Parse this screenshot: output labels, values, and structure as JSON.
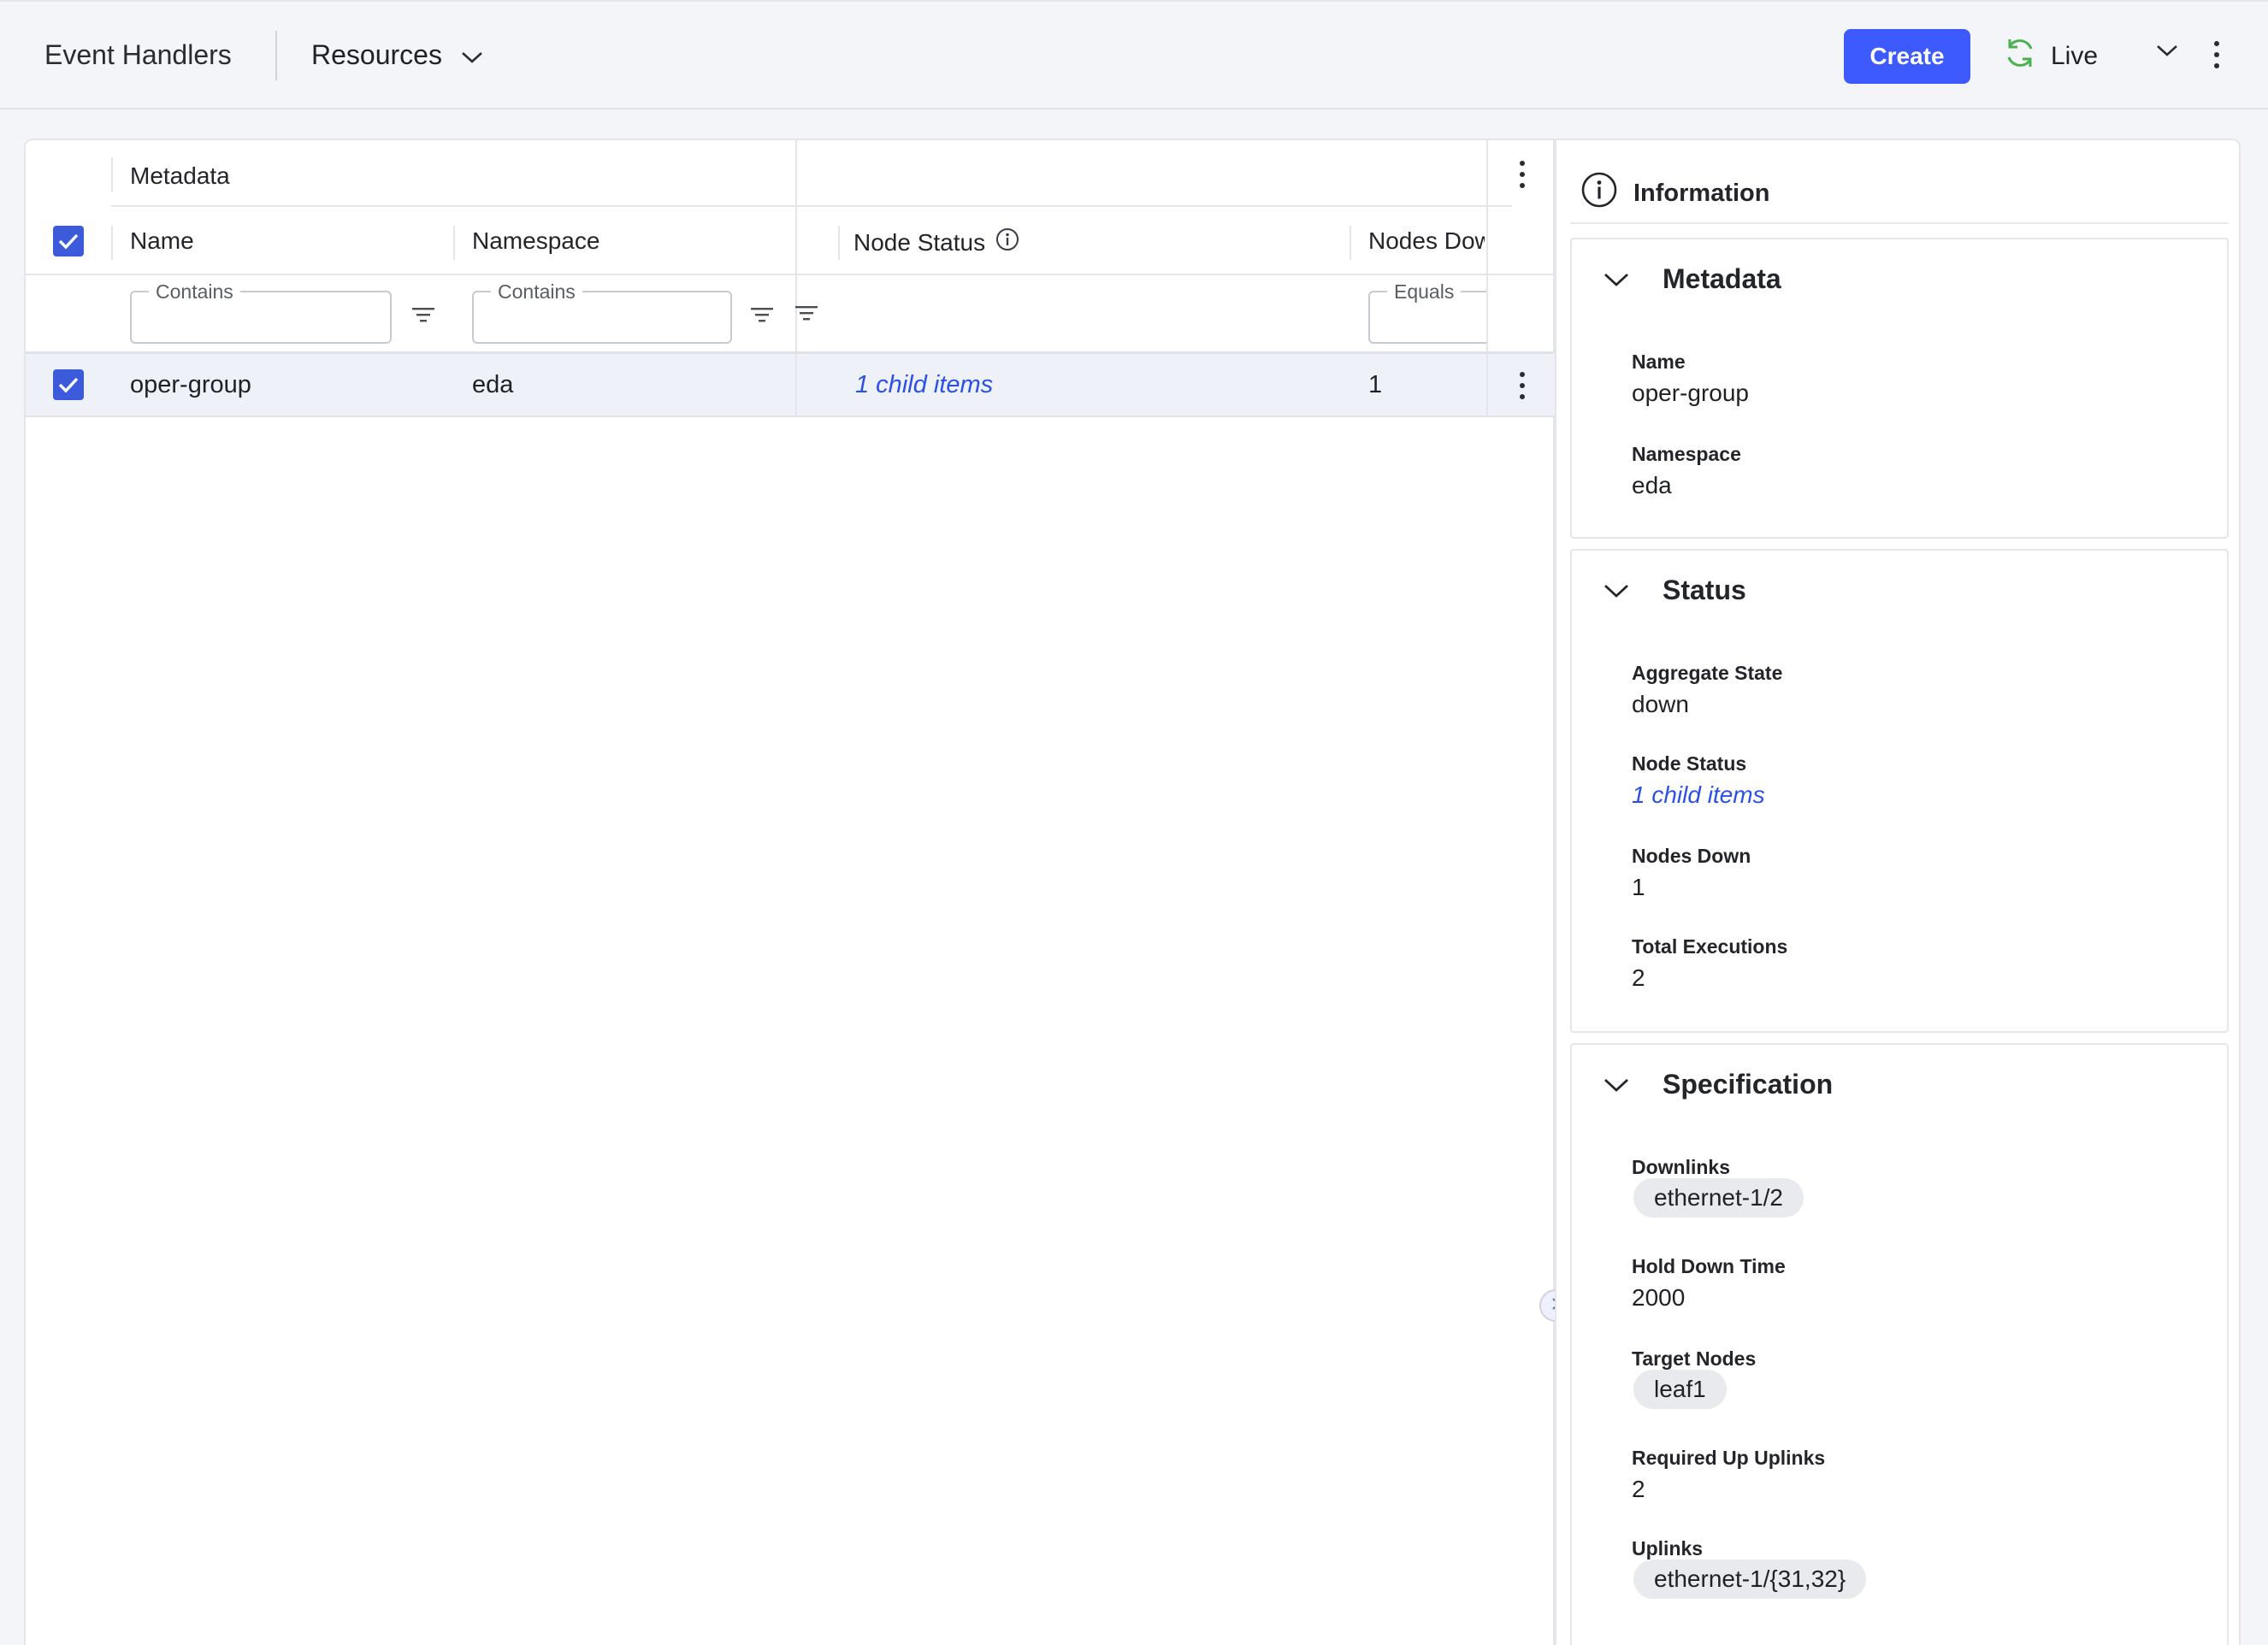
{
  "header": {
    "title": "Event Handlers",
    "resources_label": "Resources",
    "create_label": "Create",
    "live_label": "Live"
  },
  "table": {
    "group_header": "Metadata",
    "columns": {
      "name": "Name",
      "namespace": "Namespace",
      "node_status": "Node Status",
      "nodes_down": "Nodes Dow"
    },
    "filters": {
      "name_legend": "Contains",
      "namespace_legend": "Contains",
      "nodes_down_legend": "Equals"
    },
    "rows": [
      {
        "name": "oper-group",
        "namespace": "eda",
        "node_status": "1 child items",
        "nodes_down": "1",
        "selected": true
      }
    ]
  },
  "info": {
    "title": "Information",
    "metadata": {
      "title": "Metadata",
      "name_label": "Name",
      "name_value": "oper-group",
      "namespace_label": "Namespace",
      "namespace_value": "eda"
    },
    "status": {
      "title": "Status",
      "aggregate_label": "Aggregate State",
      "aggregate_value": "down",
      "node_status_label": "Node Status",
      "node_status_value": "1 child items",
      "nodes_down_label": "Nodes Down",
      "nodes_down_value": "1",
      "total_exec_label": "Total Executions",
      "total_exec_value": "2"
    },
    "spec": {
      "title": "Specification",
      "downlinks_label": "Downlinks",
      "downlinks_value": "ethernet-1/2",
      "hold_label": "Hold Down Time",
      "hold_value": "2000",
      "target_label": "Target Nodes",
      "target_value": "leaf1",
      "required_label": "Required Up Uplinks",
      "required_value": "2",
      "uplinks_label": "Uplinks",
      "uplinks_value": "ethernet-1/{31,32}"
    }
  },
  "colors": {
    "primary": "#3d5afe",
    "checkbox": "#3b5bdb",
    "link": "#2b50e8",
    "live_green": "#4caf50"
  }
}
